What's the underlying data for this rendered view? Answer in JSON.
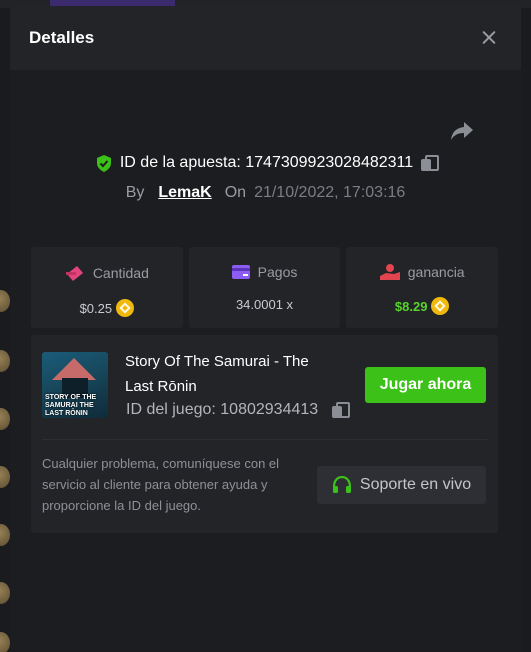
{
  "modal": {
    "title": "Detalles"
  },
  "bet": {
    "id_label": "ID de la apuesta: 1747309923028482311",
    "by_label": "By",
    "user": "LemaK",
    "on_label": "On",
    "date": "21/10/2022, 17:03:16"
  },
  "stats": [
    {
      "label": "Cantidad",
      "value": "$0.25",
      "icon": "money-icon",
      "color": "#e2447b",
      "coin": true
    },
    {
      "label": "Pagos",
      "value": "34.0001 x",
      "icon": "card-icon",
      "color": "#8b5cf6",
      "coin": false
    },
    {
      "label": "ganancia",
      "value": "$8.29",
      "icon": "profit-icon",
      "color": "#e2454f",
      "coin": true,
      "value_color": "#57d32a"
    }
  ],
  "game": {
    "name": "Story Of The Samurai - The Last Rōnin",
    "id_label": "ID del juego: 10802934413",
    "play_label": "Jugar ahora",
    "thumb_text": "STORY OF THE SAMURAI THE LAST RŌNIN"
  },
  "support": {
    "help_text": "Cualquier problema, comuníquese con el servicio al cliente para obtener ayuda y proporcione la ID del juego.",
    "button_label": "Soporte en vivo",
    "accent": "#3bc117"
  }
}
